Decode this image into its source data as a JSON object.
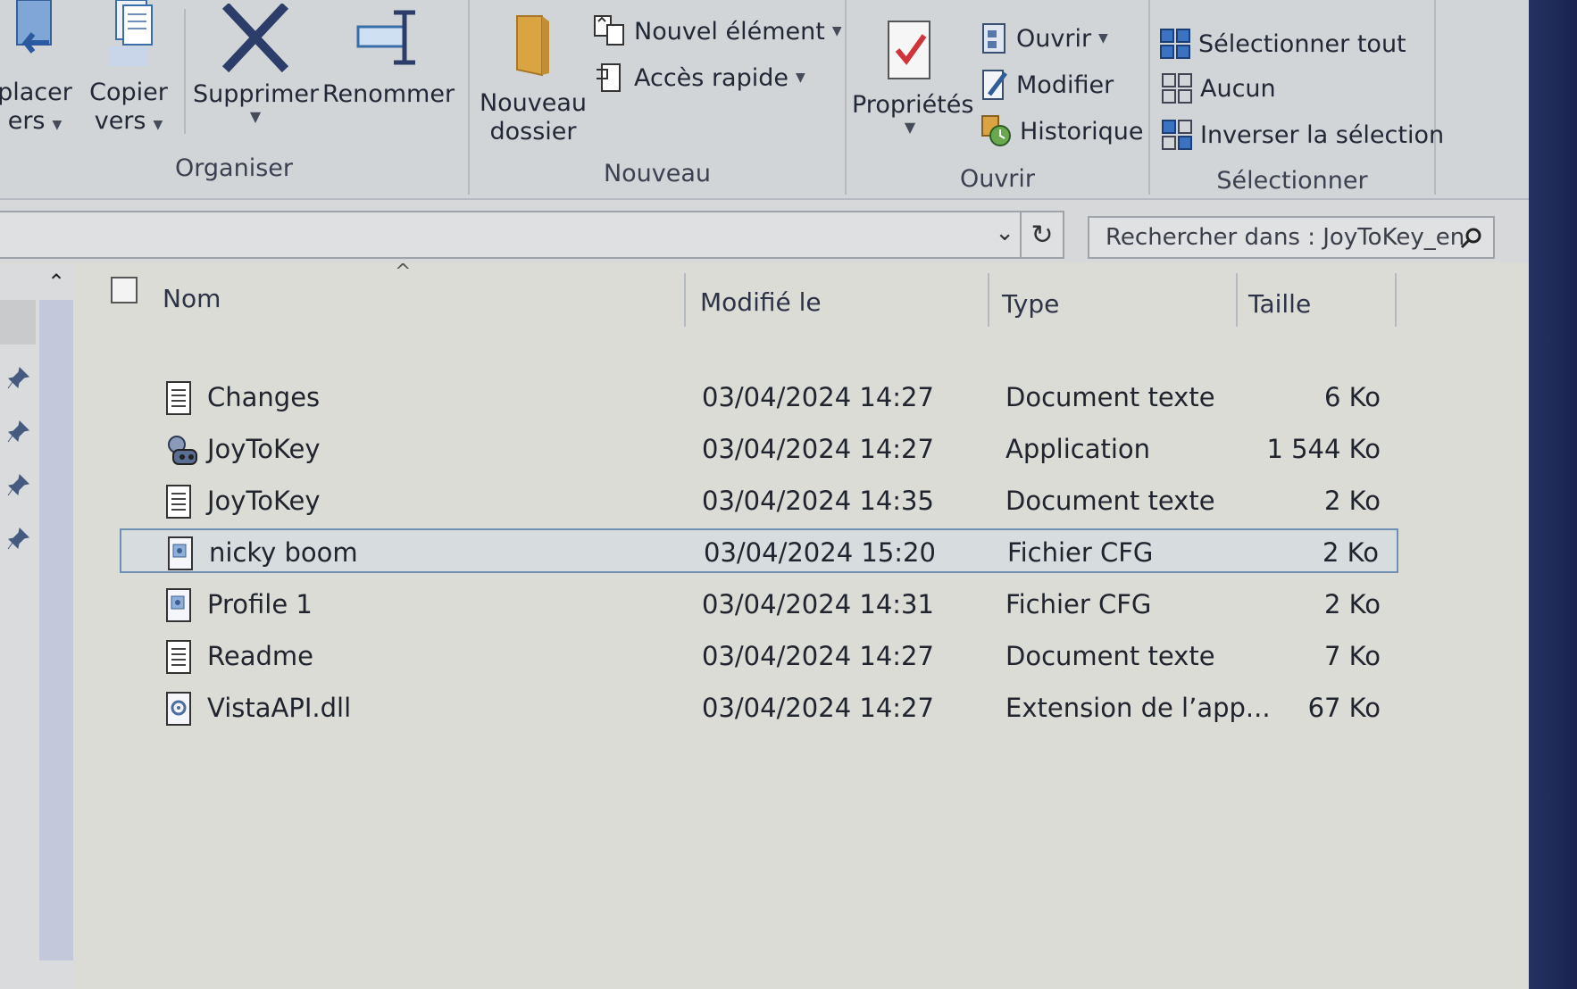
{
  "ribbon": {
    "organiser": {
      "label": "Organiser",
      "move_to": {
        "line1": "placer",
        "line2": "ers"
      },
      "copy_to": {
        "line1": "Copier",
        "line2": "vers"
      },
      "delete": "Supprimer",
      "rename": "Renommer"
    },
    "nouveau": {
      "label": "Nouveau",
      "new_folder": {
        "line1": "Nouveau",
        "line2": "dossier"
      },
      "new_item": "Nouvel élément",
      "quick_access": "Accès rapide"
    },
    "ouvrir": {
      "label": "Ouvrir",
      "properties": "Propriétés",
      "open": "Ouvrir",
      "edit": "Modifier",
      "history": "Historique"
    },
    "selectionner": {
      "label": "Sélectionner",
      "select_all": "Sélectionner tout",
      "select_none": "Aucun",
      "invert": "Inverser la sélection"
    }
  },
  "search": {
    "placeholder": "Rechercher dans : JoyToKey_en"
  },
  "columns": {
    "name": "Nom",
    "modified": "Modifié le",
    "type": "Type",
    "size": "Taille"
  },
  "files": [
    {
      "name": "Changes",
      "modified": "03/04/2024 14:27",
      "type": "Document texte",
      "size": "6 Ko",
      "icon": "text-file-icon"
    },
    {
      "name": "JoyToKey",
      "modified": "03/04/2024 14:27",
      "type": "Application",
      "size": "1 544 Ko",
      "icon": "application-icon"
    },
    {
      "name": "JoyToKey",
      "modified": "03/04/2024 14:35",
      "type": "Document texte",
      "size": "2 Ko",
      "icon": "text-file-icon"
    },
    {
      "name": "nicky boom",
      "modified": "03/04/2024 15:20",
      "type": "Fichier CFG",
      "size": "2 Ko",
      "icon": "config-file-icon",
      "selected": true
    },
    {
      "name": "Profile 1",
      "modified": "03/04/2024 14:31",
      "type": "Fichier CFG",
      "size": "2 Ko",
      "icon": "config-file-icon"
    },
    {
      "name": "Readme",
      "modified": "03/04/2024 14:27",
      "type": "Document texte",
      "size": "7 Ko",
      "icon": "text-file-icon"
    },
    {
      "name": "VistaAPI.dll",
      "modified": "03/04/2024 14:27",
      "type": "Extension de l’app...",
      "size": "67 Ko",
      "icon": "dll-file-icon"
    }
  ]
}
